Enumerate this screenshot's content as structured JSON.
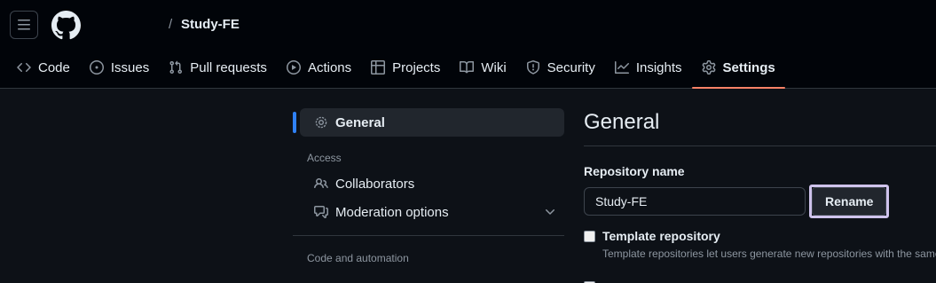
{
  "header": {
    "separator": "/",
    "repo_name": "Study-FE"
  },
  "tabs": [
    {
      "label": "Code",
      "icon": "code-icon"
    },
    {
      "label": "Issues",
      "icon": "issue-opened-icon"
    },
    {
      "label": "Pull requests",
      "icon": "git-pull-request-icon"
    },
    {
      "label": "Actions",
      "icon": "play-icon"
    },
    {
      "label": "Projects",
      "icon": "table-icon"
    },
    {
      "label": "Wiki",
      "icon": "book-icon"
    },
    {
      "label": "Security",
      "icon": "shield-icon"
    },
    {
      "label": "Insights",
      "icon": "graph-icon"
    },
    {
      "label": "Settings",
      "icon": "gear-icon",
      "active": true
    }
  ],
  "sidebar": {
    "general": "General",
    "access_heading": "Access",
    "collaborators": "Collaborators",
    "moderation": "Moderation options",
    "code_heading": "Code and automation"
  },
  "main": {
    "title": "General",
    "repo_name_label": "Repository name",
    "repo_name_value": "Study-FE",
    "rename_button": "Rename",
    "template_label": "Template repository",
    "template_note": "Template repositories let users generate new repositories with the same"
  },
  "colors": {
    "accent_tab": "#f78166",
    "accent_sidebar": "#2f81f7",
    "highlight": "#cfc3ec"
  }
}
